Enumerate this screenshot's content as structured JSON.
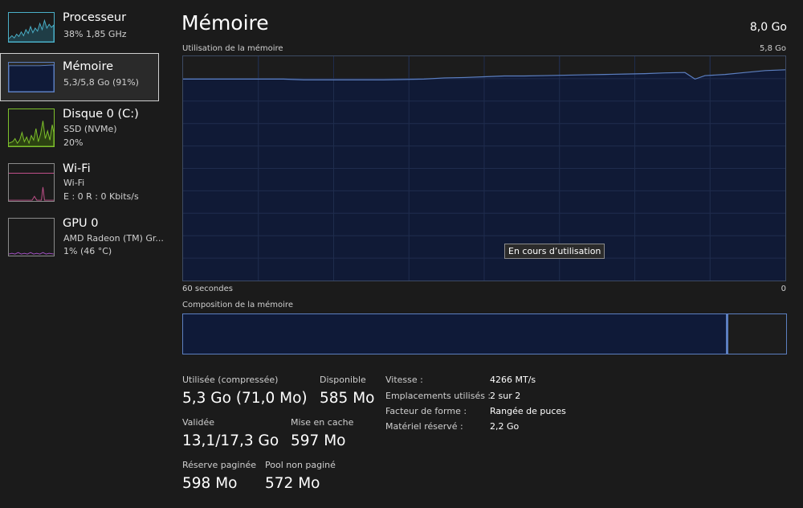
{
  "sidebar": {
    "items": [
      {
        "title": "Processeur",
        "sub1": "38%  1,85 GHz",
        "sub2": "",
        "color": "#4ab0c8"
      },
      {
        "title": "Mémoire",
        "sub1": "5,3/5,8 Go (91%)",
        "sub2": "",
        "color": "#5c7fc0"
      },
      {
        "title": "Disque 0 (C:)",
        "sub1": "SSD (NVMe)",
        "sub2": "20%",
        "color": "#7ec12c"
      },
      {
        "title": "Wi-Fi",
        "sub1": "Wi-Fi",
        "sub2": "E : 0  R : 0 Kbits/s",
        "color": "#c0508a"
      },
      {
        "title": "GPU 0",
        "sub1": "AMD Radeon (TM) Gr...",
        "sub2": "1%  (46 °C)",
        "color": "#a050c0"
      }
    ]
  },
  "main": {
    "title": "Mémoire",
    "total": "8,0 Go",
    "usage_label": "Utilisation de la mémoire",
    "usage_max": "5,8 Go",
    "time_start": "60 secondes",
    "time_end": "0",
    "tooltip": "En cours d’utilisation",
    "composition_label": "Composition de la mémoire"
  },
  "composition": {
    "used_fraction": 0.903,
    "standby_fraction": 0.097
  },
  "stats": {
    "used_label": "Utilisée (compressée)",
    "used_value": "5,3 Go (71,0 Mo)",
    "available_label": "Disponible",
    "available_value": "585 Mo",
    "committed_label": "Validée",
    "committed_value": "13,1/17,3 Go",
    "cached_label": "Mise en cache",
    "cached_value": "597 Mo",
    "paged_label": "Réserve paginée",
    "paged_value": "598 Mo",
    "nonpaged_label": "Pool non paginé",
    "nonpaged_value": "572 Mo"
  },
  "specs": [
    {
      "label": "Vitesse :",
      "value": "4266 MT/s"
    },
    {
      "label": "Emplacements utilisés :",
      "value": "2 sur 2"
    },
    {
      "label": "Facteur de forme :",
      "value": "Rangée de puces"
    },
    {
      "label": "Matériel réservé :",
      "value": "2,2 Go"
    }
  ],
  "chart_data": {
    "type": "area",
    "ylabel": "Utilisation de la mémoire",
    "ylim": [
      0,
      5.8
    ],
    "xlim": [
      60,
      0
    ],
    "x": [
      60,
      58,
      56,
      54,
      52,
      50,
      48,
      46,
      44,
      42,
      40,
      38,
      36,
      34,
      32,
      30,
      28,
      26,
      24,
      22,
      20,
      18,
      16,
      14,
      12,
      10,
      9,
      8,
      6,
      4,
      2,
      0
    ],
    "values": [
      5.21,
      5.21,
      5.21,
      5.21,
      5.21,
      5.21,
      5.19,
      5.19,
      5.19,
      5.19,
      5.19,
      5.2,
      5.21,
      5.24,
      5.25,
      5.27,
      5.29,
      5.29,
      5.3,
      5.31,
      5.32,
      5.33,
      5.34,
      5.35,
      5.37,
      5.38,
      5.21,
      5.3,
      5.33,
      5.38,
      5.43,
      5.45
    ]
  }
}
